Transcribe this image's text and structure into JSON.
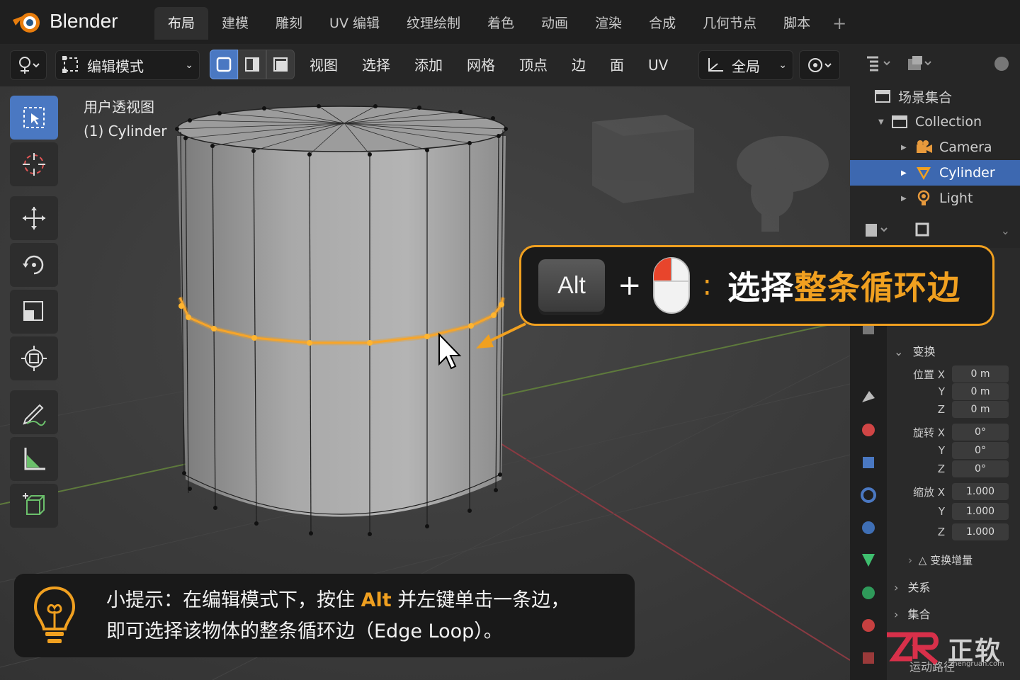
{
  "app": {
    "name": "Blender"
  },
  "tabs": [
    "布局",
    "建模",
    "雕刻",
    "UV 编辑",
    "纹理绘制",
    "着色",
    "动画",
    "渲染",
    "合成",
    "几何节点",
    "脚本"
  ],
  "tab_add": "+",
  "header": {
    "mode": "编辑模式",
    "menus": [
      "视图",
      "选择",
      "添加",
      "网格",
      "顶点",
      "边",
      "面",
      "UV"
    ],
    "transform_orientation": "全局"
  },
  "viewport": {
    "view_name": "用户透视图",
    "object_label": "(1) Cylinder"
  },
  "outliner": {
    "scene_collection": "场景集合",
    "items": [
      {
        "label": "Collection"
      },
      {
        "label": "Camera"
      },
      {
        "label": "Cylinder"
      },
      {
        "label": "Light"
      }
    ]
  },
  "properties": {
    "transform_title": "变换",
    "location_label": "位置 X",
    "rotation_label": "旋转 X",
    "scale_label": "缩放 X",
    "axis_y": "Y",
    "axis_z": "Z",
    "location": [
      "0 m",
      "0 m",
      "0 m"
    ],
    "rotation": [
      "0°",
      "0°",
      "0°"
    ],
    "scale": [
      "1.000",
      "1.000",
      "1.000"
    ],
    "delta_transform": "△ 变换增量",
    "relations": "关系",
    "collections": "集合",
    "motion_paths": "运动路径"
  },
  "callout": {
    "key": "Alt",
    "plus": "+",
    "colon": ":",
    "text_prefix": "选择",
    "text_highlight": "整条循环边"
  },
  "tip": {
    "line1_prefix": "小提示：在编辑模式下，按住 ",
    "line1_key": "Alt",
    "line1_suffix": " 并左键单击一条边，",
    "line2": "即可选择该物体的整条循环边（Edge Loop）。"
  },
  "watermark": {
    "brand": "正软",
    "url": "zhengruan.com"
  },
  "colors": {
    "accent": "#f0a020",
    "selection": "#4a78c2",
    "outliner_selected": "#3d68b0"
  }
}
